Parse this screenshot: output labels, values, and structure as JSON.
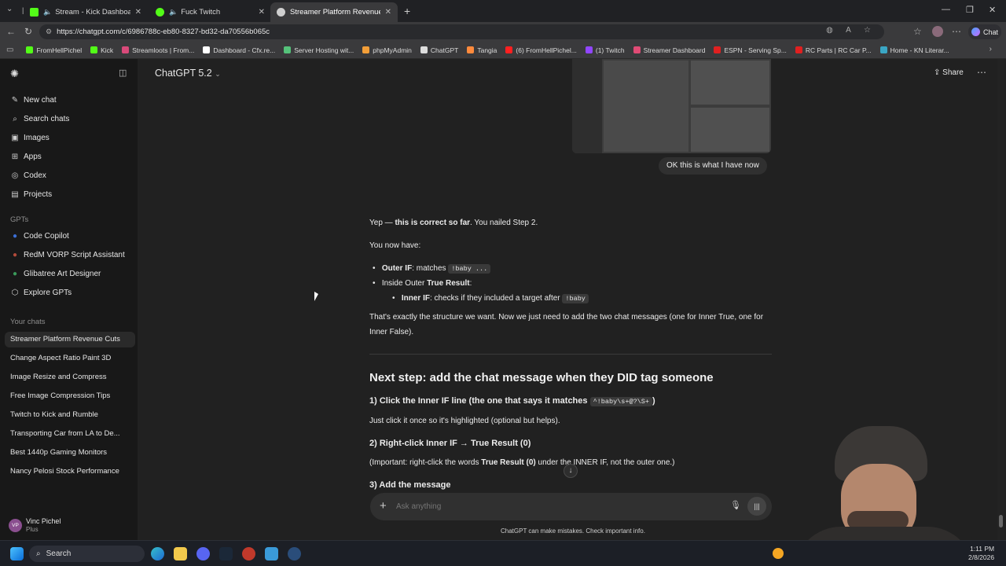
{
  "browser": {
    "tabs": [
      {
        "title": "Stream - Kick Dashboard",
        "color": "#53fc18",
        "active": false
      },
      {
        "title": "Fuck Twitch",
        "color": "#53fc18",
        "active": false
      },
      {
        "title": "Streamer Platform Revenue Cuts",
        "color": "#cfcfcf",
        "active": true
      }
    ],
    "url": "https://chatgpt.com/c/6986788c-eb80-8327-bd32-da70556b065c",
    "bookmarks": [
      {
        "label": "FromHellPichel",
        "color": "#53fc18"
      },
      {
        "label": "Kick",
        "color": "#53fc18"
      },
      {
        "label": "Streamloots | From...",
        "color": "#d94a7a"
      },
      {
        "label": "Dashboard - Cfx.re...",
        "color": "#ffffff"
      },
      {
        "label": "Server Hosting wit...",
        "color": "#55c27a"
      },
      {
        "label": "phpMyAdmin",
        "color": "#f29e38"
      },
      {
        "label": "ChatGPT",
        "color": "#dddddd"
      },
      {
        "label": "Tangia",
        "color": "#ff8a3c"
      },
      {
        "label": "(6) FromHellPichel...",
        "color": "#ff2020"
      },
      {
        "label": "(1) Twitch",
        "color": "#9146ff"
      },
      {
        "label": "Streamer Dashboard",
        "color": "#e04b75"
      },
      {
        "label": "ESPN - Serving Sp...",
        "color": "#e02020"
      },
      {
        "label": "RC Parts | RC Car P...",
        "color": "#e02020"
      },
      {
        "label": "Home - KN Literar...",
        "color": "#3aa6c4"
      }
    ],
    "chat_label": "Chat"
  },
  "sidebar": {
    "items": [
      {
        "label": "New chat",
        "icon": "edit-icon"
      },
      {
        "label": "Search chats",
        "icon": "search-icon"
      },
      {
        "label": "Images",
        "icon": "image-icon"
      },
      {
        "label": "Apps",
        "icon": "apps-icon"
      },
      {
        "label": "Codex",
        "icon": "codex-icon"
      },
      {
        "label": "Projects",
        "icon": "folder-icon"
      }
    ],
    "gpts_label": "GPTs",
    "gpts": [
      {
        "label": "Code Copilot",
        "color": "#3b6fd6"
      },
      {
        "label": "RedM VORP Script Assistant",
        "color": "#b34a3a"
      },
      {
        "label": "Glibatree Art Designer",
        "color": "#3a9a5a"
      },
      {
        "label": "Explore GPTs",
        "color": "#cfcfcf"
      }
    ],
    "chats_label": "Your chats",
    "chats": [
      "Streamer Platform Revenue Cuts",
      "Change Aspect Ratio Paint 3D",
      "Image Resize and Compress",
      "Free Image Compression Tips",
      "Twitch to Kick and Rumble",
      "Transporting Car from LA to De...",
      "Best 1440p Gaming Monitors",
      "Nancy Pelosi Stock Performance"
    ],
    "user": {
      "initials": "VP",
      "name": "Vinc Pichel",
      "plan": "Plus"
    }
  },
  "header": {
    "model": "ChatGPT 5.2",
    "share": "Share"
  },
  "conversation": {
    "user_message": "OK this is what I have now",
    "p1_a": "Yep — ",
    "p1_b": "this is correct so far",
    "p1_c": ". You nailed Step 2.",
    "p2": "You now have:",
    "b1_label": "Outer IF",
    "b1_text": ": matches ",
    "b1_code": "!baby ...",
    "b2_text": "Inside Outer ",
    "b2_bold": "True Result",
    "b2_end": ":",
    "b3_label": "Inner IF",
    "b3_text": ": checks if they included a target after ",
    "b3_code": "!baby",
    "p3": "That's exactly the structure we want. Now we just need to add the two chat messages (one for Inner True, one for Inner False).",
    "h_next": "Next step: add the chat message when they DID tag someone",
    "s1_title": "1) Click the Inner IF line (the one that says it matches ",
    "s1_code": "^!baby\\s+@?\\S+",
    "s1_end": ")",
    "s1_text": "Just click it once so it's highlighted (optional but helps).",
    "s2_title": "2) Right-click Inner IF → True Result (0)",
    "s2_a": "(Important: right-click the words ",
    "s2_bold": "True Result (0)",
    "s2_b": " under the INNER IF, not the outer one.)",
    "s3_title": "3) Add the message"
  },
  "composer": {
    "placeholder": "Ask anything",
    "disclaimer": "ChatGPT can make mistakes. Check important info."
  },
  "taskbar": {
    "search": "Search",
    "time": "1:11 PM",
    "date": "2/8/2026"
  }
}
